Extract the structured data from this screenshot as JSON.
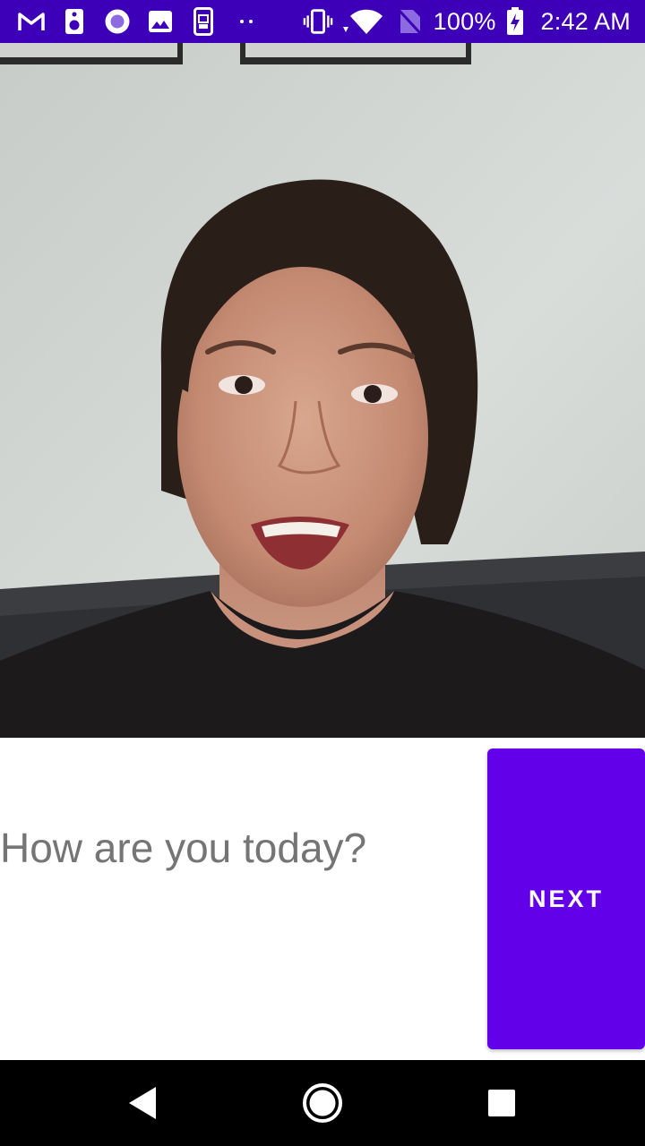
{
  "status_bar": {
    "icons_left": [
      "gmail-icon",
      "speaker-icon",
      "record-icon",
      "image-icon",
      "screenshot-icon",
      "more-dots-icon"
    ],
    "icons_right": [
      "vibrate-icon",
      "wifi-icon",
      "no-sim-icon",
      "battery-charging-icon"
    ],
    "battery": "100%",
    "time": "2:42 AM",
    "color": "#3d00b8"
  },
  "camera": {
    "content": "camera-preview"
  },
  "prompt": {
    "text": "How are you today?"
  },
  "next_button": {
    "label": "NEXT",
    "color": "#6200ea"
  },
  "nav_bar": {
    "buttons": [
      "back-icon",
      "home-icon",
      "recents-icon"
    ]
  }
}
